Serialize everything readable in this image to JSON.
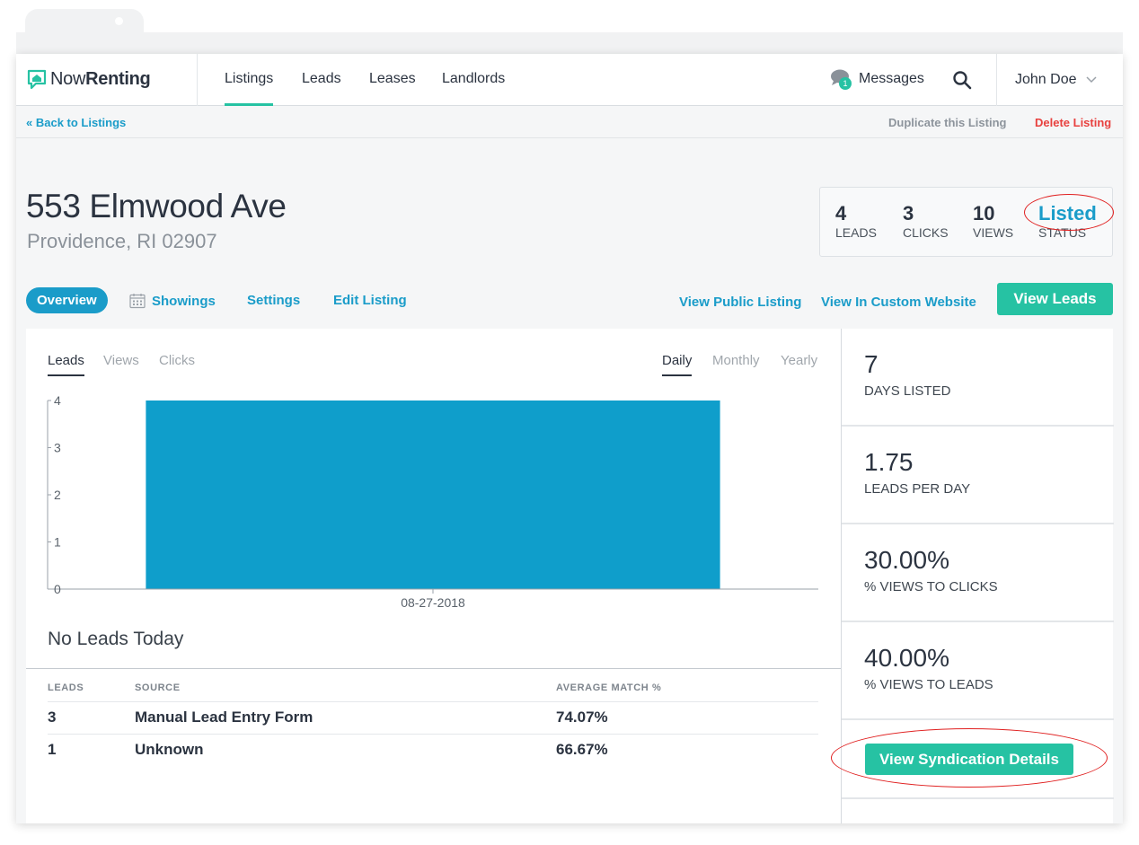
{
  "nav": {
    "logo_now": "Now",
    "logo_renting": "Renting",
    "tabs": [
      {
        "label": "Listings",
        "active": true
      },
      {
        "label": "Leads",
        "active": false
      },
      {
        "label": "Leases",
        "active": false
      },
      {
        "label": "Landlords",
        "active": false
      }
    ],
    "messages_label": "Messages",
    "messages_badge": "1",
    "user_name": "John Doe",
    "icons": {
      "messages": "chat-bubbles-icon",
      "search": "search-icon",
      "user_menu": "chevron-down-icon",
      "logo": "house-chat-icon"
    }
  },
  "subbar": {
    "back_label": "« Back to Listings",
    "duplicate_label": "Duplicate this Listing",
    "delete_label": "Delete Listing"
  },
  "listing": {
    "address": "553 Elmwood Ave",
    "city": "Providence, RI 02907"
  },
  "stats": [
    {
      "value": "4",
      "label": "LEADS"
    },
    {
      "value": "3",
      "label": "CLICKS"
    },
    {
      "value": "10",
      "label": "VIEWS"
    },
    {
      "value": "Listed",
      "label": "STATUS"
    }
  ],
  "tabs": {
    "overview": "Overview",
    "showings": "Showings",
    "settings": "Settings",
    "edit": "Edit Listing",
    "view_public": "View Public Listing",
    "view_custom": "View In Custom Website",
    "view_leads": "View Leads"
  },
  "chart_tabs": {
    "metrics": [
      "Leads",
      "Views",
      "Clicks"
    ],
    "periods": [
      "Daily",
      "Monthly",
      "Yearly"
    ],
    "active_metric": "Leads",
    "active_period": "Daily"
  },
  "chart_data": {
    "type": "bar",
    "categories": [
      "08-27-2018"
    ],
    "values": [
      4
    ],
    "title": "",
    "xlabel": "",
    "ylabel": "",
    "ylim": [
      0,
      4
    ],
    "yticks": [
      0,
      1,
      2,
      3,
      4
    ],
    "grid": false,
    "color": "#0f9ecb"
  },
  "chart_message": "No Leads Today",
  "table": {
    "headers": [
      "LEADS",
      "SOURCE",
      "AVERAGE MATCH %"
    ],
    "rows": [
      [
        "3",
        "Manual Lead Entry Form",
        "74.07%"
      ],
      [
        "1",
        "Unknown",
        "66.67%"
      ]
    ]
  },
  "side": {
    "cards": [
      {
        "value": "7",
        "label": "DAYS LISTED"
      },
      {
        "value": "1.75",
        "label": "LEADS PER DAY"
      },
      {
        "value": "30.00%",
        "label": "% VIEWS TO CLICKS"
      },
      {
        "value": "40.00%",
        "label": "% VIEWS TO LEADS"
      }
    ],
    "syndication_label": "View Syndication Details"
  },
  "colors": {
    "accent_green": "#26c2a3",
    "accent_blue": "#1a9cc9",
    "danger": "#e8413f",
    "annotation": "#e02020"
  }
}
